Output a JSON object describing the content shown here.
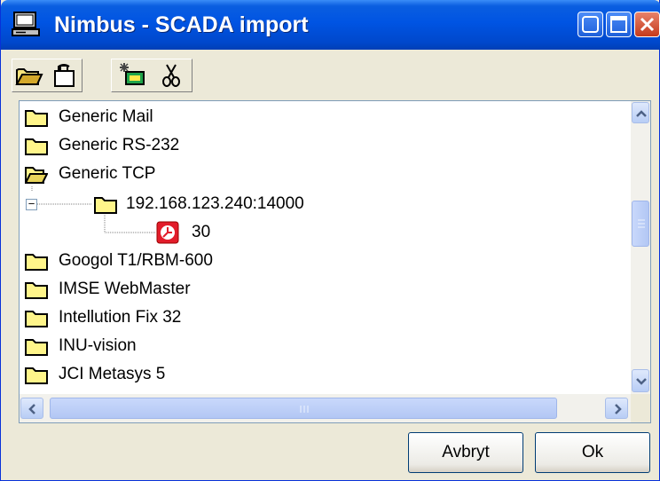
{
  "window": {
    "title": "Nimbus - SCADA import"
  },
  "toolbar": {
    "buttons": [
      {
        "icon": "open-folder-icon"
      },
      {
        "icon": "open-file-icon"
      },
      {
        "icon": "new-item-icon"
      },
      {
        "icon": "cut-icon"
      }
    ]
  },
  "tree": {
    "items": [
      {
        "label": "Generic Mail",
        "icon": "folder-icon",
        "level": 0
      },
      {
        "label": "Generic RS-232",
        "icon": "folder-icon",
        "level": 0
      },
      {
        "label": "Generic TCP",
        "icon": "open-folder-icon",
        "level": 0
      },
      {
        "label": "192.168.123.240:14000",
        "icon": "folder-icon",
        "level": 1,
        "expanded": true
      },
      {
        "label": "30",
        "icon": "clock-icon",
        "level": 2
      },
      {
        "label": "Googol T1/RBM-600",
        "icon": "folder-icon",
        "level": 0
      },
      {
        "label": "IMSE WebMaster",
        "icon": "folder-icon",
        "level": 0
      },
      {
        "label": "Intellution Fix 32",
        "icon": "folder-icon",
        "level": 0
      },
      {
        "label": "INU-vision",
        "icon": "folder-icon",
        "level": 0
      },
      {
        "label": "JCI Metasys 5",
        "icon": "folder-icon",
        "level": 0
      }
    ],
    "expander_symbol": "−"
  },
  "buttons": {
    "cancel_label": "Avbryt",
    "ok_label": "Ok"
  },
  "colors": {
    "titlebar": "#0054e3",
    "window_bg": "#ece9d8",
    "close_button": "#c53a1c",
    "clock_icon": "#e21c2a"
  }
}
